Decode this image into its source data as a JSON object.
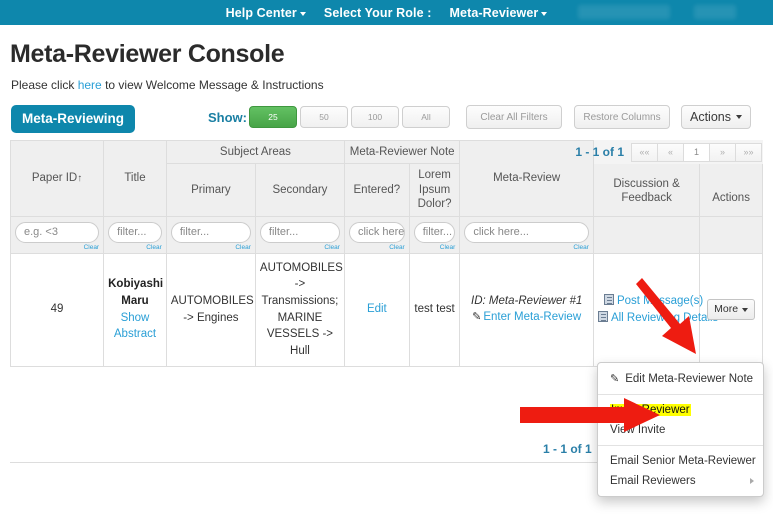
{
  "topnav": {
    "items": [
      {
        "label": "Help Center",
        "caret": true
      },
      {
        "label": "Select Your Role :",
        "caret": false
      },
      {
        "label": "Meta-Reviewer",
        "caret": true
      }
    ]
  },
  "page": {
    "title": "Meta-Reviewer Console",
    "instructions_before": "Please click ",
    "instructions_link": "here",
    "instructions_after": " to view Welcome Message & Instructions",
    "tab_label": "Meta-Reviewing"
  },
  "toolbar": {
    "show_label": "Show:",
    "page_sizes": [
      "25",
      "50",
      "100",
      "All"
    ],
    "active_page_size": "25",
    "clear_all_filters": "Clear All Filters",
    "restore_columns": "Restore Columns",
    "actions": "Actions"
  },
  "pagination": {
    "count_text": "1 - 1 of 1",
    "first": "««",
    "prev": "«",
    "current": "1",
    "next": "»",
    "last": "»»",
    "bottom_count_text": "1 - 1 of 1"
  },
  "table": {
    "headers": {
      "paper_id": "Paper ID",
      "sort_glyph": "↑",
      "title": "Title",
      "subject_areas": "Subject Areas",
      "primary": "Primary",
      "secondary": "Secondary",
      "meta_reviewer_note": "Meta-Reviewer Note",
      "entered": "Entered?",
      "lorem": "Lorem Ipsum Dolor?",
      "meta_review": "Meta-Review",
      "discussion_feedback": "Discussion & Feedback",
      "actions": "Actions"
    },
    "filters": [
      {
        "placeholder": "e.g. <3",
        "clear": "Clear"
      },
      {
        "placeholder": "filter...",
        "clear": "Clear"
      },
      {
        "placeholder": "filter...",
        "clear": "Clear"
      },
      {
        "placeholder": "filter...",
        "clear": "Clear"
      },
      {
        "placeholder": "click here...",
        "clear": "Clear"
      },
      {
        "placeholder": "filter...",
        "clear": "Clear"
      },
      {
        "placeholder": "click here...",
        "clear": "Clear"
      }
    ],
    "rows": [
      {
        "paper_id": "49",
        "title": "Kobiyashi Maru",
        "show_abstract": "Show Abstract",
        "primary": "AUTOMOBILES -> Engines",
        "secondary": "AUTOMOBILES -> Transmissions; MARINE VESSELS -> Hull",
        "note_entered": "Edit",
        "lorem": "test test",
        "meta_review_id": "ID: Meta-Reviewer #1",
        "meta_review_action": "Enter Meta-Review",
        "discussion_post": "Post Message(s)",
        "discussion_details": "All Reviewing Details",
        "actions_more": "More"
      }
    ]
  },
  "dropdown": {
    "items": [
      {
        "label": "Edit Meta-Reviewer Note",
        "icon": "pencil-icon",
        "highlighted": false,
        "submenu": false
      },
      {
        "separator": true
      },
      {
        "label": "Invite Reviewer",
        "highlighted": true,
        "submenu": false
      },
      {
        "label": "View Invite",
        "highlighted": false,
        "submenu": false
      },
      {
        "separator": true
      },
      {
        "label": "Email Senior Meta-Reviewer",
        "highlighted": false,
        "submenu": false
      },
      {
        "label": "Email Reviewers",
        "highlighted": false,
        "submenu": true
      }
    ]
  },
  "colors": {
    "brand": "#0e87ac",
    "link": "#2a9fd6",
    "accent_green": "#47a447",
    "highlight": "#ffff00",
    "arrow_red": "#ee1c11"
  }
}
